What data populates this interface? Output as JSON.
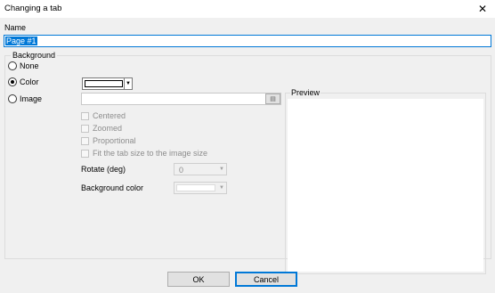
{
  "window": {
    "title": "Changing a tab",
    "close_glyph": "✕"
  },
  "name": {
    "label": "Name",
    "value": "Page #1"
  },
  "background": {
    "legend": "Background",
    "options": {
      "none": "None",
      "color": "Color",
      "image": "Image"
    },
    "selected": "color",
    "color_value": "#ffffff",
    "image_value": ""
  },
  "image_options": {
    "centered": "Centered",
    "zoomed": "Zoomed",
    "proportional": "Proportional",
    "fit": "Fit the tab size to the image size"
  },
  "rotate": {
    "label": "Rotate (deg)",
    "value": "0"
  },
  "bgcolor": {
    "label": "Background color"
  },
  "preview": {
    "label": "Preview"
  },
  "buttons": {
    "ok": "OK",
    "cancel": "Cancel"
  },
  "icons": {
    "close": "close-icon",
    "dropdown": "chevron-down-icon",
    "browse": "folder-icon"
  }
}
